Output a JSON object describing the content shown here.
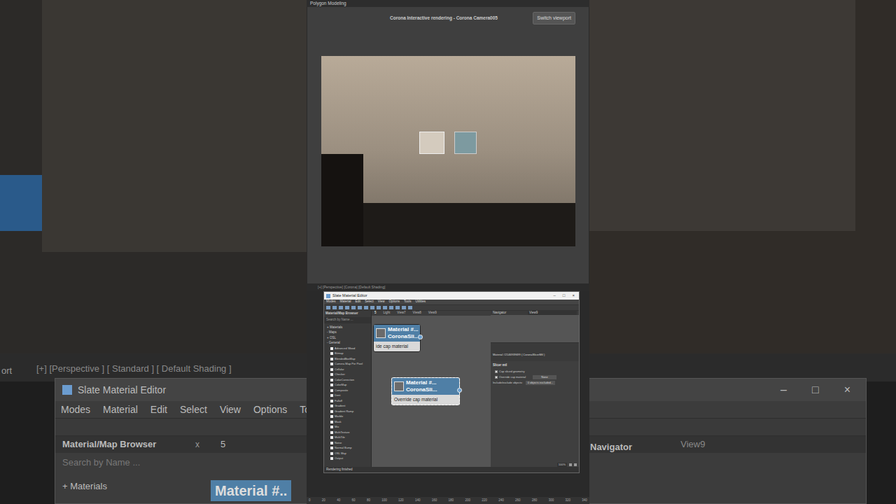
{
  "background": {
    "viewport_label": "[+] [Perspective ] [ Standard ] [ Default Shading ]",
    "side_label": "ort",
    "editor_title": "Slate Material Editor",
    "window_buttons": [
      "–",
      "□",
      "×"
    ],
    "menu": [
      "Modes",
      "Material",
      "Edit",
      "Select",
      "View",
      "Options",
      "Too"
    ],
    "browser_title": "Material/Map Browser",
    "browser_close": "x",
    "tab_num": "5",
    "search_placeholder": "Search by Name ...",
    "materials": "+ Materials",
    "node": "Material #..",
    "view": "View9",
    "navigator": "Navigator"
  },
  "app": {
    "title": "Polygon Modeling"
  },
  "render_window": {
    "title": "Corona Interactive rendering - Corona Camera005",
    "button": "Switch viewport"
  },
  "viewport_bar": "[+] [Perspective] [Corona] [Default Shading]",
  "editor": {
    "title": "Slate Material Editor",
    "window_buttons": [
      "–",
      "□",
      "×"
    ],
    "menu": [
      "Modes",
      "Material",
      "Edit",
      "Select",
      "View",
      "Options",
      "Tools",
      "Utilities"
    ],
    "browser_title": "Material/Map Browser",
    "search": "Search by Name ...",
    "tree": [
      "+ Materials",
      "- Maps",
      "+ OSL",
      "- General"
    ],
    "maps": [
      "Advanced Wood",
      "Bitmap",
      "BlendedBoxMap",
      "Camera Map Per Pixel",
      "Cellular",
      "Checker",
      "ColorCorrection",
      "ColorMap",
      "Composite",
      "Dent",
      "Falloff",
      "Gradient",
      "Gradient Ramp",
      "Marble",
      "Mask",
      "Mix",
      "MultiTexture",
      "MultiTile",
      "Noise",
      "Normal Bump",
      "OSL Map",
      "Output"
    ],
    "tabs": [
      {
        "label": "5",
        "selected": true
      },
      {
        "label": "Light",
        "selected": false
      },
      {
        "label": "View7",
        "selected": false
      },
      {
        "label": "View8",
        "selected": false
      },
      {
        "label": "View9",
        "selected": false
      }
    ],
    "nodes": [
      {
        "title": "Material #...",
        "subtitle": "CoronaSli...",
        "slot": "ide cap material",
        "selected": false
      },
      {
        "title": "Material #...",
        "subtitle": "CoronaSli...",
        "slot": "Override cap material",
        "selected": true
      }
    ],
    "navigator": "Navigator",
    "view_select": "View9",
    "params": {
      "header": "Material #2146939699  ( CoronaSlicerMtl )",
      "rollout": "Slicer mtl",
      "checks": [
        {
          "label": "Cap sliced geometry",
          "checked": true
        },
        {
          "label": "Override cap material",
          "checked": true
        }
      ],
      "none": "None",
      "include_label": "Include/exclude objects:",
      "include_value": "0 objects excluded..."
    },
    "zoom": "100%",
    "status": "Rendering finished"
  },
  "timeline": [
    "0",
    "20",
    "40",
    "60",
    "80",
    "100",
    "120",
    "140",
    "160",
    "180",
    "200",
    "220",
    "240",
    "260",
    "280",
    "300",
    "320",
    "340"
  ]
}
